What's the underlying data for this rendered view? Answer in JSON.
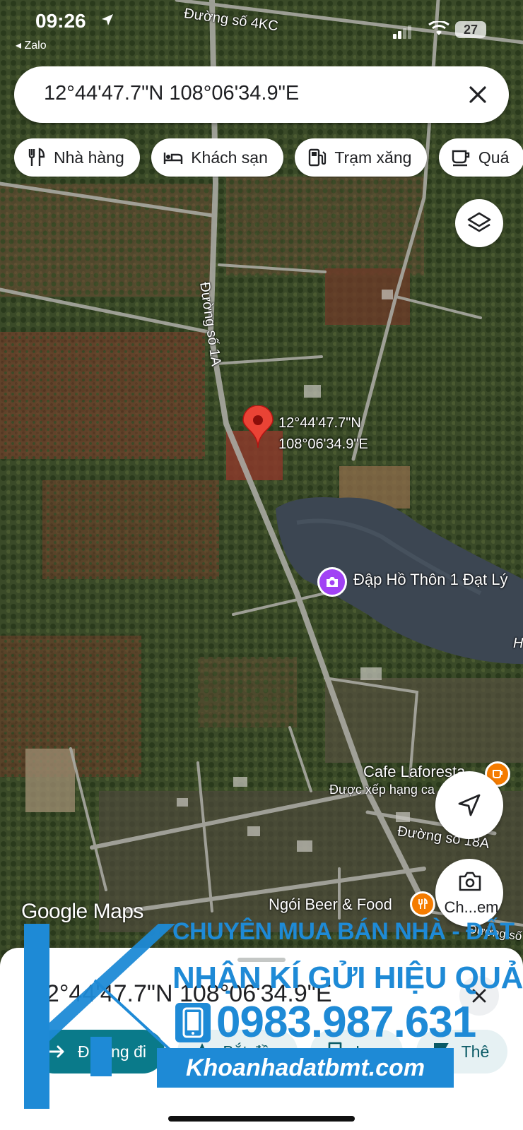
{
  "status_bar": {
    "time": "09:26",
    "back_label": "◂ Zalo",
    "battery": "27"
  },
  "search": {
    "query": "12°44'47.7\"N 108°06'34.9\"E"
  },
  "chips": [
    {
      "label": "Nhà hàng",
      "icon": "restaurant-icon"
    },
    {
      "label": "Khách sạn",
      "icon": "hotel-icon"
    },
    {
      "label": "Trạm xăng",
      "icon": "gas-station-icon"
    },
    {
      "label": "Quá",
      "icon": "cafe-icon"
    }
  ],
  "map": {
    "road_labels": {
      "road_4kc": "Đường số 4KC",
      "road_1a": "Đường số 1A",
      "road_18a": "Đường số 18A",
      "road_partial": "Đường số"
    },
    "pin": {
      "lat": "12°44'47.7\"N",
      "lng": "108°06'34.9\"E"
    },
    "poi_lake": "Đập Hồ Thôn 1 Đạt Lý",
    "poi_cafe": {
      "name": "Cafe Laforesta",
      "subtitle": "Được xếp hạng ca"
    },
    "poi_beer": "Ngói Beer & Food",
    "partial_letter": "H",
    "logo": "Google Maps"
  },
  "fabs": {
    "camera_label": "Ch...em"
  },
  "sheet": {
    "title": "12°44'47.7\"N 108°06'34.9\"E",
    "actions": [
      {
        "label": "Đường đi",
        "icon": "directions-icon"
      },
      {
        "label": "Bắt đầu",
        "icon": "navigation-icon"
      },
      {
        "label": "Lưu",
        "icon": "bookmark-icon"
      },
      {
        "label": "Thê",
        "icon": "flag-icon"
      }
    ]
  },
  "watermark": {
    "line1": "CHUYÊN MUA BÁN NHÀ - ĐẤT",
    "line2": "NHẬN KÍ GỬI HIỆU QUẢ",
    "phone": "0983.987.631",
    "site": "Khoanhadatbmt.com"
  },
  "colors": {
    "pin_red": "#ea4335",
    "poi_purple": "#a142f4",
    "poi_orange": "#f57c00",
    "watermark_blue": "#1e8ad6",
    "lake": "#3c4652"
  }
}
